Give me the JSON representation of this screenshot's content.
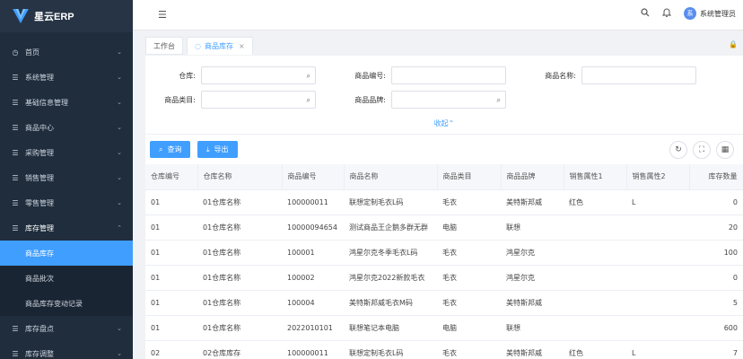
{
  "app": {
    "name": "星云ERP",
    "logo_icon": "v-logo-icon",
    "brand_color": "#409eff"
  },
  "sidebar": {
    "items": [
      {
        "label": "首页",
        "icon": "clock-icon"
      },
      {
        "label": "系统管理",
        "icon": "menu-icon"
      },
      {
        "label": "基础信息管理",
        "icon": "menu-icon"
      },
      {
        "label": "商品中心",
        "icon": "menu-icon"
      },
      {
        "label": "采购管理",
        "icon": "menu-icon"
      },
      {
        "label": "销售管理",
        "icon": "menu-icon"
      },
      {
        "label": "零售管理",
        "icon": "menu-icon"
      },
      {
        "label": "库存管理",
        "icon": "menu-icon"
      }
    ],
    "subitems": [
      {
        "label": "商品库存"
      },
      {
        "label": "商品批次"
      },
      {
        "label": "商品库存变动记录"
      }
    ],
    "after_items": [
      {
        "label": "库存盘点",
        "icon": "menu-icon"
      },
      {
        "label": "库存调整",
        "icon": "menu-icon"
      }
    ]
  },
  "header": {
    "user_initial": "系",
    "user_name": "系统管理员"
  },
  "tabs": [
    {
      "label": "工作台"
    },
    {
      "label": "商品库存"
    }
  ],
  "filters": {
    "warehouse_label": "仓库:",
    "product_code_label": "商品编号:",
    "product_name_label": "商品名称:",
    "category_label": "商品类目:",
    "brand_label": "商品品牌:",
    "collapse_label": "收起"
  },
  "actions": {
    "query_label": "查询",
    "export_label": "导出"
  },
  "table": {
    "columns": [
      "仓库编号",
      "仓库名称",
      "商品编号",
      "商品名称",
      "商品类目",
      "商品品牌",
      "销售属性1",
      "销售属性2",
      "库存数量"
    ],
    "rows": [
      [
        "01",
        "01仓库名称",
        "100000011",
        "联想定制毛衣L码",
        "毛衣",
        "美特斯邦威",
        "红色",
        "L",
        "0"
      ],
      [
        "01",
        "01仓库名称",
        "10000094654",
        "测试商品王企鹅多群无群",
        "电脑",
        "联想",
        "",
        "",
        "20"
      ],
      [
        "01",
        "01仓库名称",
        "100001",
        "鸿星尔克冬季毛衣L码",
        "毛衣",
        "鸿星尔克",
        "",
        "",
        "100"
      ],
      [
        "01",
        "01仓库名称",
        "100002",
        "鸿星尔克2022新款毛衣",
        "毛衣",
        "鸿星尔克",
        "",
        "",
        "0"
      ],
      [
        "01",
        "01仓库名称",
        "100004",
        "美特斯邦威毛衣M码",
        "毛衣",
        "美特斯邦威",
        "",
        "",
        "5"
      ],
      [
        "01",
        "01仓库名称",
        "2022010101",
        "联想笔记本电脑",
        "电脑",
        "联想",
        "",
        "",
        "600"
      ],
      [
        "02",
        "02仓库库存",
        "100000011",
        "联想定制毛衣L码",
        "毛衣",
        "美特斯邦威",
        "红色",
        "L",
        "7"
      ]
    ]
  }
}
